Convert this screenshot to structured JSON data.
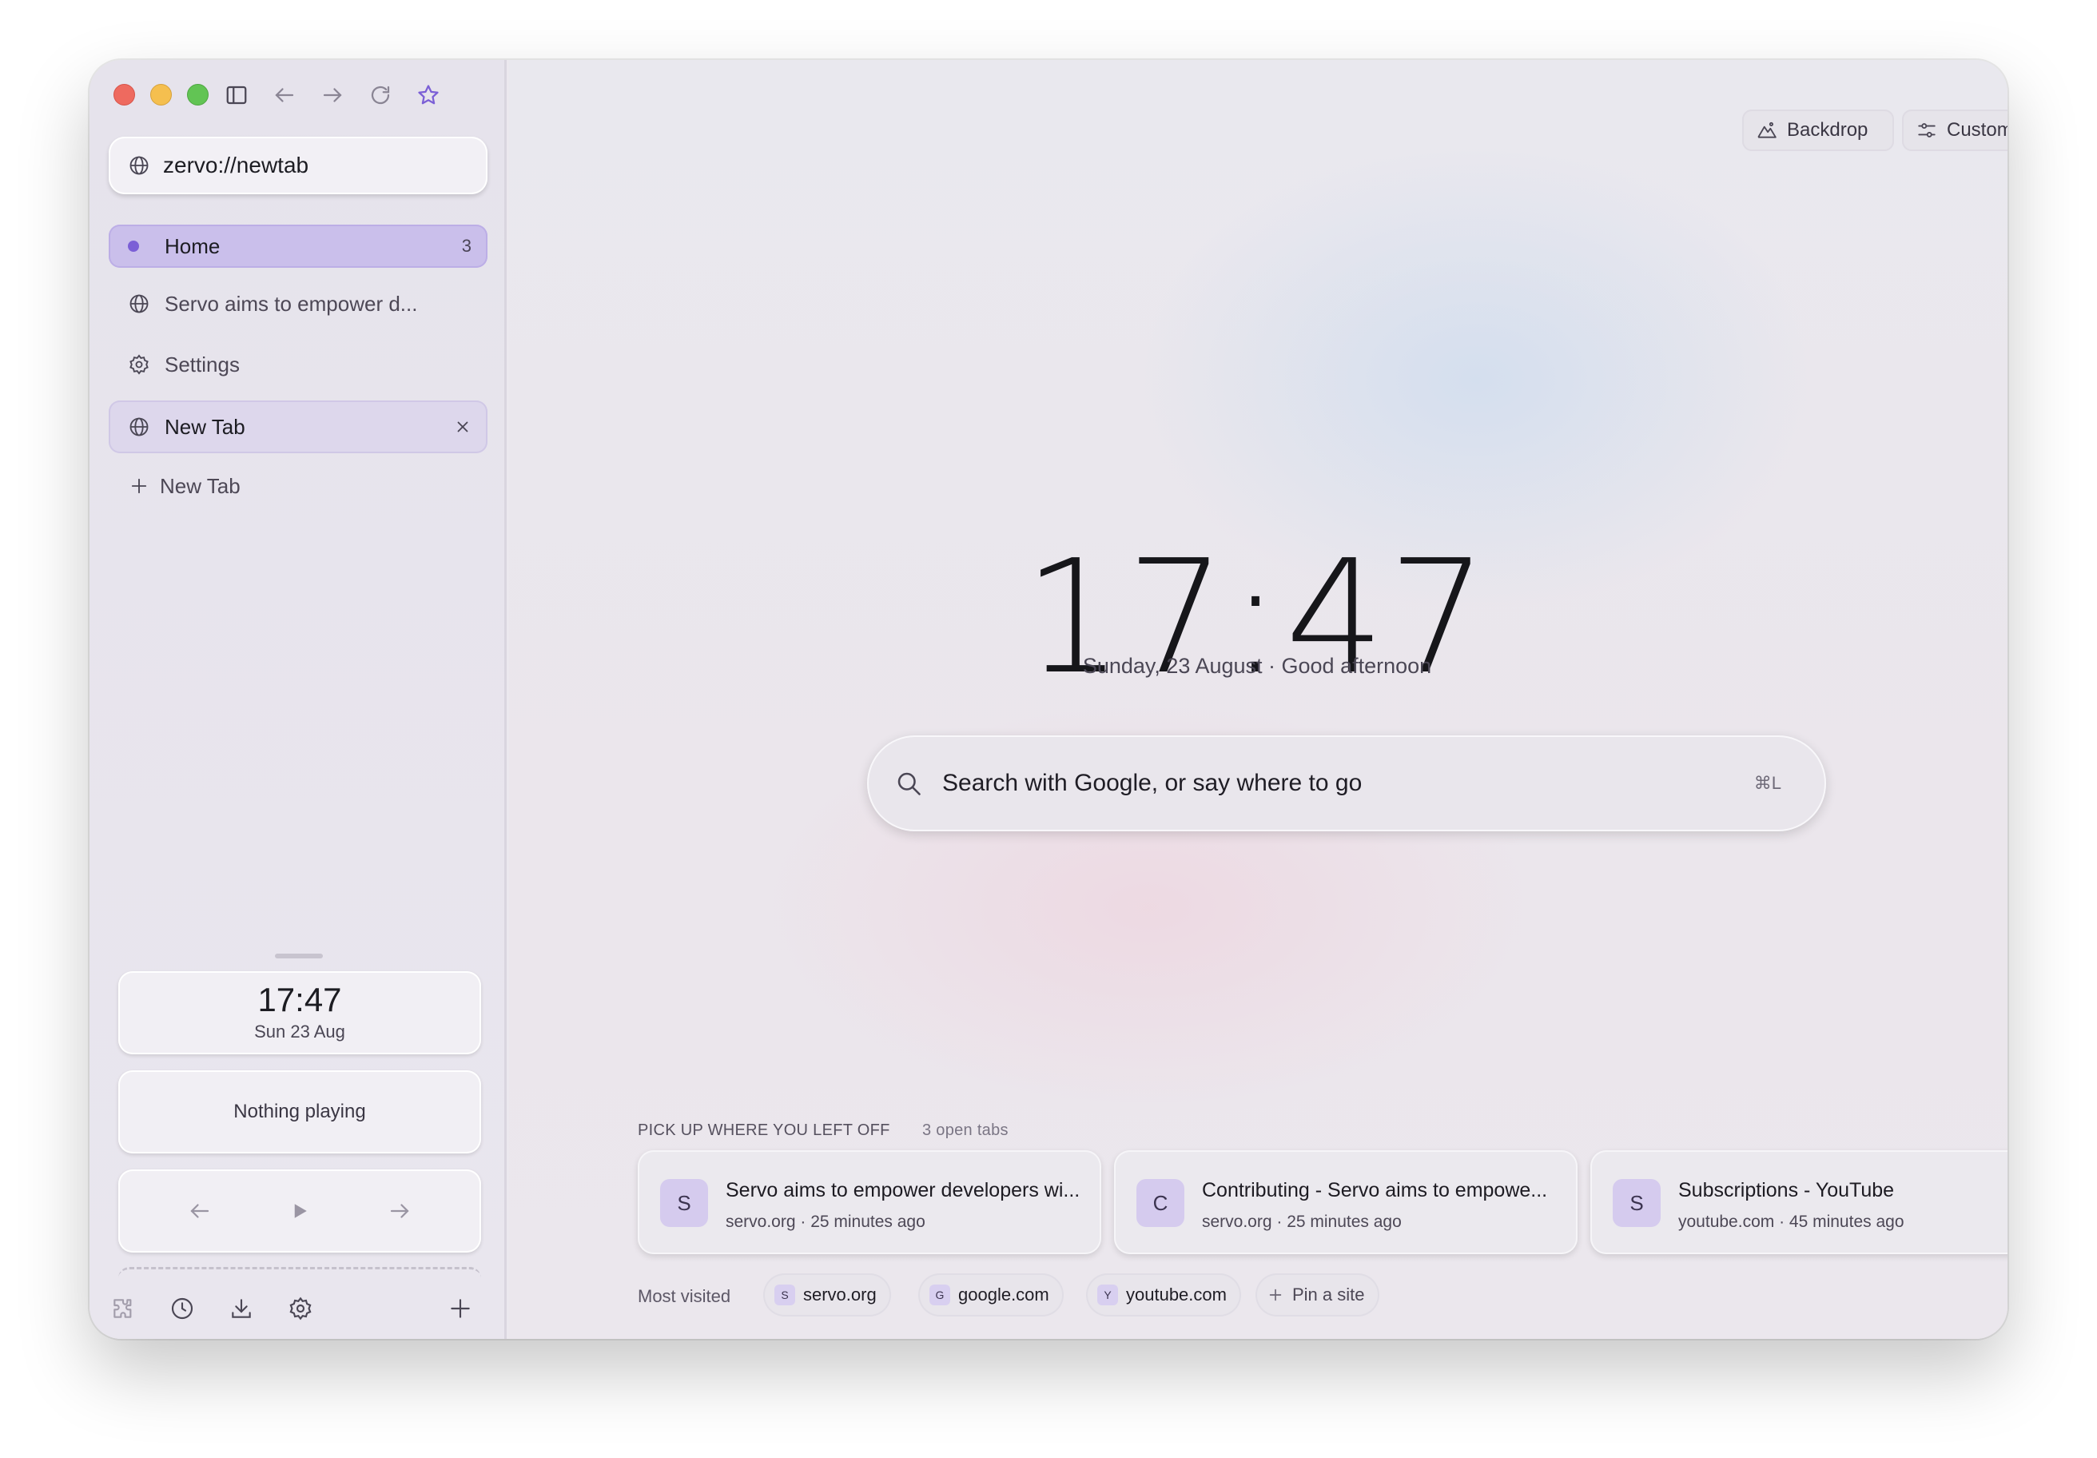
{
  "sidebar": {
    "url": "zervo://newtab",
    "tabs": {
      "home": {
        "label": "Home",
        "count": "3"
      },
      "servo": {
        "label": "Servo aims to empower d..."
      },
      "settings": {
        "label": "Settings"
      },
      "active": {
        "label": "New Tab"
      },
      "add": {
        "label": "New Tab"
      }
    },
    "widgets": {
      "clock_time": "17:47",
      "clock_date": "Sun 23 Aug",
      "media": "Nothing playing"
    }
  },
  "main": {
    "backdrop_label": "Backdrop",
    "customise_label": "Customise",
    "clock": "17:47",
    "date_line": "Sunday, 23 August · Good afternoon",
    "search": {
      "placeholder": "Search with Google, or say where to go",
      "shortcut": "⌘L"
    },
    "pickup": {
      "title": "PICK UP WHERE YOU LEFT OFF",
      "count": "3 open tabs",
      "cards": [
        {
          "badge": "S",
          "title": "Servo aims to empower developers wi...",
          "sub": "servo.org · 25 minutes ago"
        },
        {
          "badge": "C",
          "title": "Contributing - Servo aims to empowe...",
          "sub": "servo.org · 25 minutes ago"
        },
        {
          "badge": "S",
          "title": "Subscriptions - YouTube",
          "sub": "youtube.com · 45 minutes ago"
        }
      ]
    },
    "most_visited": {
      "label": "Most visited",
      "sites": [
        {
          "badge": "S",
          "label": "servo.org"
        },
        {
          "badge": "G",
          "label": "google.com"
        },
        {
          "badge": "Y",
          "label": "youtube.com"
        }
      ],
      "pin_label": "Pin a site"
    }
  },
  "colors": {
    "accent": "#7b5fd6",
    "home_tab_bg": "#cabfeb",
    "star": "#7b5fd6"
  },
  "icons": [
    "sidebar-toggle-icon",
    "back-arrow-icon",
    "forward-arrow-icon",
    "reload-icon",
    "star-icon",
    "globe-icon",
    "gear-icon",
    "close-icon",
    "plus-icon",
    "prev-icon",
    "play-icon",
    "next-icon",
    "puzzle-icon",
    "history-icon",
    "download-icon",
    "mountain-icon",
    "sliders-icon",
    "search-icon"
  ]
}
